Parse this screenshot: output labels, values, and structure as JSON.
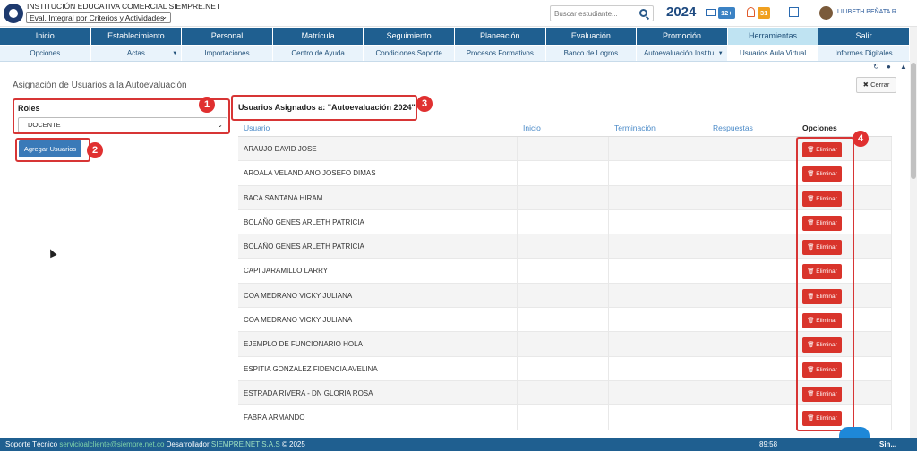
{
  "header": {
    "institution": "INSTITUCIÓN EDUCATIVA COMERCIAL SIEMPRE.NET",
    "eval_select": "Eval. Integral por Criterios y Actividades",
    "search_placeholder": "Buscar estudiante...",
    "year": "2024",
    "mail_badge": "12+",
    "bell_badge": "31",
    "user": "LILIBETH PEÑATA R..."
  },
  "main_nav": [
    {
      "label": "Inicio"
    },
    {
      "label": "Establecimiento"
    },
    {
      "label": "Personal"
    },
    {
      "label": "Matrícula"
    },
    {
      "label": "Seguimiento"
    },
    {
      "label": "Planeación"
    },
    {
      "label": "Evaluación"
    },
    {
      "label": "Promoción"
    },
    {
      "label": "Herramientas"
    },
    {
      "label": "Salir"
    }
  ],
  "sub_nav": [
    {
      "label": "Opciones",
      "caret": ""
    },
    {
      "label": "Actas",
      "caret": "▼"
    },
    {
      "label": "Importaciones",
      "caret": ""
    },
    {
      "label": "Centro de Ayuda",
      "caret": ""
    },
    {
      "label": "Condiciones Soporte",
      "caret": ""
    },
    {
      "label": "Procesos Formativos",
      "caret": ""
    },
    {
      "label": "Banco de Logros",
      "caret": ""
    },
    {
      "label": "Autoevaluación Institu...",
      "caret": "▼"
    },
    {
      "label": "Usuarios Aula Virtual",
      "caret": ""
    },
    {
      "label": "Informes Digitales",
      "caret": ""
    }
  ],
  "page": {
    "title": "Asignación de Usuarios a la Autoevaluación",
    "close_label": "Cerrar",
    "roles_label": "Roles",
    "roles_value": "DOCENTE",
    "add_users_label": "Agregar Usuarios",
    "assigned_title": "Usuarios Asignados a: \"Autoevaluación 2024\""
  },
  "table": {
    "columns": [
      "Usuario",
      "Inicio",
      "Terminación",
      "Respuestas",
      "Opciones"
    ],
    "delete_label": "Eliminar",
    "rows": [
      "ARAUJO DAVID JOSE",
      "AROALA VELANDIANO JOSEFO DIMAS",
      "BACA SANTANA HIRAM",
      "BOLAÑO GENES ARLETH PATRICIA",
      "BOLAÑO GENES ARLETH PATRICIA",
      "CAPI JARAMILLO LARRY",
      "COA MEDRANO VICKY JULIANA",
      "COA MEDRANO VICKY JULIANA",
      "EJEMPLO DE FUNCIONARIO HOLA",
      "ESPITIA GONZALEZ FIDENCIA AVELINA",
      "ESTRADA RIVERA - DN GLORIA ROSA",
      "FABRA ARMANDO"
    ]
  },
  "annotations": [
    "1",
    "2",
    "3",
    "4"
  ],
  "footer": {
    "support_label": "Soporte Técnico",
    "email": "servicioalcliente@siempre.net.co",
    "developer_label": "Desarrollador",
    "company": "SIEMPRE.NET S.A.S",
    "copyright": "© 2025",
    "time": "89:58",
    "brand": "Sin..."
  },
  "colors": {
    "nav_blue": "#1f5f90",
    "active_tab": "#bfe3f2",
    "delete_red": "#d9342b",
    "annotation_red": "#d73535",
    "primary_button": "#3a7ab8"
  }
}
